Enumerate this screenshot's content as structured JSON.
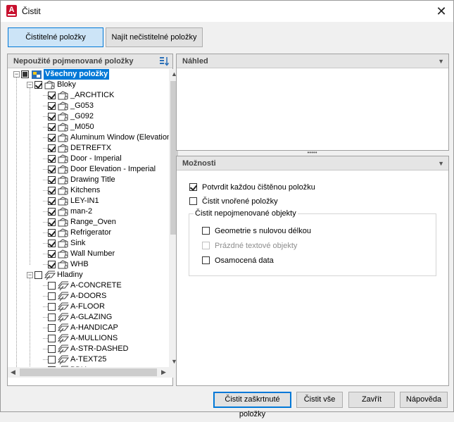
{
  "window": {
    "title": "Čistit",
    "app_icon_letter": "A",
    "close_glyph": "✕"
  },
  "tabs": [
    {
      "label": "Čistitelné položky",
      "active": true
    },
    {
      "label": "Najít nečistitelné položky",
      "active": false
    }
  ],
  "tree_panel": {
    "header": "Nepoužité pojmenované položky",
    "root": {
      "label": "Všechny položky"
    },
    "groups": [
      {
        "label": "Bloky",
        "items": [
          "_ARCHTICK",
          "_G053",
          "_G092",
          "_M050",
          "Aluminum Window (Elevation)",
          "DETREFTX",
          "Door - Imperial",
          "Door Elevation - Imperial",
          "Drawing Title",
          "Kitchens",
          "LEY-IN1",
          "man-2",
          "Range_Oven",
          "Refrigerator",
          "Sink",
          "Wall Number",
          "WHB"
        ]
      },
      {
        "label": "Hladiny",
        "items": [
          "A-CONCRETE",
          "A-DOORS",
          "A-FLOOR",
          "A-GLAZING",
          "A-HANDICAP",
          "A-MULLIONS",
          "A-STR-DASHED",
          "A-TEXT25",
          "BDY"
        ]
      }
    ]
  },
  "preview_panel": {
    "header": "Náhled"
  },
  "splitter_glyph": "•••••",
  "options_panel": {
    "header": "Možnosti",
    "confirm_each": {
      "label": "Potvrdit každou čištěnou položku",
      "checked": true
    },
    "purge_nested": {
      "label": "Čistit vnořené položky",
      "checked": false
    },
    "unnamed_group": {
      "legend": "Čistit nepojmenované objekty",
      "zero_length": {
        "label": "Geometrie s nulovou délkou",
        "checked": false
      },
      "empty_text": {
        "label": "Prázdné textové objekty",
        "checked": false,
        "disabled": true
      },
      "orphaned": {
        "label": "Osamocená data",
        "checked": false
      }
    }
  },
  "buttons": {
    "purge_checked": "Čistit zaškrtnuté položky",
    "purge_all": "Čistit vše",
    "close": "Zavřít",
    "help": "Nápověda"
  },
  "colors": {
    "accent": "#0078d7",
    "active_tab": "#cce4f7",
    "app_red": "#c8102e"
  }
}
